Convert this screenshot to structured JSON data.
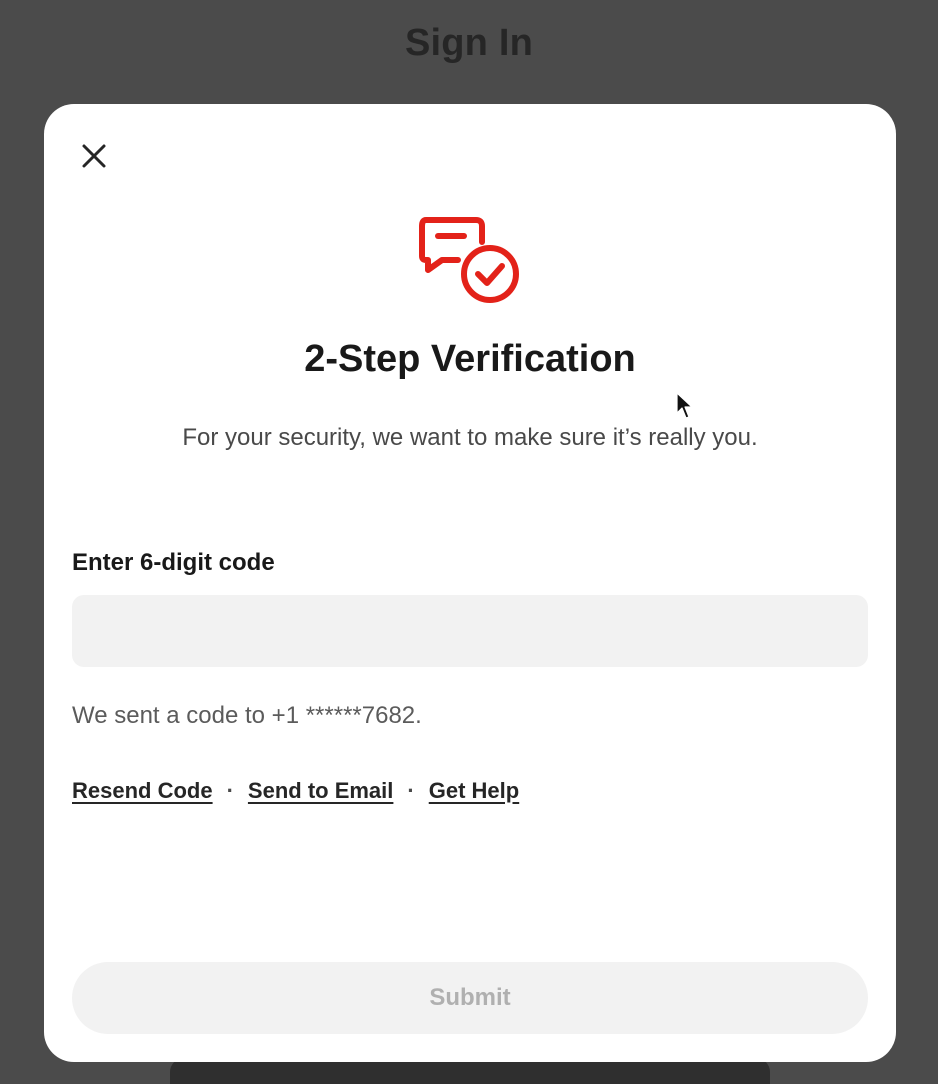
{
  "background": {
    "title": "Sign In"
  },
  "modal": {
    "close_icon": "close-icon",
    "hero_icon": "chat-check-icon",
    "heading": "2-Step Verification",
    "subtitle": "For your security, we want to make sure it’s really you.",
    "code_field": {
      "label": "Enter 6-digit code",
      "value": "",
      "placeholder": ""
    },
    "sent_note": "We sent a code to +1 ******7682.",
    "links": [
      {
        "label": "Resend Code"
      },
      {
        "label": "Send to Email"
      },
      {
        "label": "Get Help"
      }
    ],
    "separator": "·",
    "submit_label": "Submit"
  },
  "colors": {
    "accent": "#e32219",
    "overlay": "#4b4b4b",
    "input_bg": "#f2f2f2",
    "disabled_text": "#b0b0b0"
  }
}
